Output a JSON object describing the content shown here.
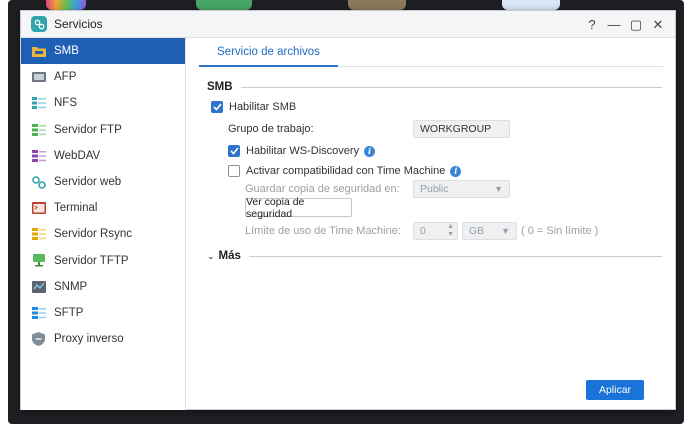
{
  "window": {
    "title": "Servicios"
  },
  "window_controls": {
    "help": "?",
    "minimize": "—",
    "maximize": "▢",
    "close": "✕"
  },
  "sidebar": {
    "items": [
      {
        "label": "SMB",
        "icon": "smb-folder-icon",
        "active": true
      },
      {
        "label": "AFP",
        "icon": "afp-icon"
      },
      {
        "label": "NFS",
        "icon": "nfs-icon"
      },
      {
        "label": "Servidor FTP",
        "icon": "ftp-icon"
      },
      {
        "label": "WebDAV",
        "icon": "webdav-icon"
      },
      {
        "label": "Servidor web",
        "icon": "web-server-icon"
      },
      {
        "label": "Terminal",
        "icon": "terminal-icon"
      },
      {
        "label": "Servidor Rsync",
        "icon": "rsync-icon"
      },
      {
        "label": "Servidor TFTP",
        "icon": "tftp-icon"
      },
      {
        "label": "SNMP",
        "icon": "snmp-icon"
      },
      {
        "label": "SFTP",
        "icon": "sftp-icon"
      },
      {
        "label": "Proxy inverso",
        "icon": "proxy-shield-icon"
      }
    ]
  },
  "tabs": {
    "active": "Servicio de archivos"
  },
  "smb": {
    "section_title": "SMB",
    "enable_label": "Habilitar SMB",
    "enable_checked": true,
    "workgroup_label": "Grupo de trabajo:",
    "workgroup_value": "WORKGROUP",
    "ws_discovery_label": "Habilitar WS-Discovery",
    "ws_discovery_checked": true,
    "time_machine_label": "Activar compatibilidad con Time Machine",
    "time_machine_checked": false,
    "backup_dest_label": "Guardar copia de seguridad en:",
    "backup_dest_value": "Public",
    "view_backup_button": "Ver copia de seguridad",
    "limit_label": "Límite de uso de Time Machine:",
    "limit_value": "0",
    "limit_unit": "GB",
    "limit_hint": "( 0 = Sin límite )"
  },
  "more": {
    "section_title": "Más"
  },
  "footer": {
    "apply_button": "Aplicar"
  },
  "colors": {
    "accent": "#1e5fb4",
    "primary_button": "#1a73d8",
    "tab_text": "#1e6bc4"
  }
}
